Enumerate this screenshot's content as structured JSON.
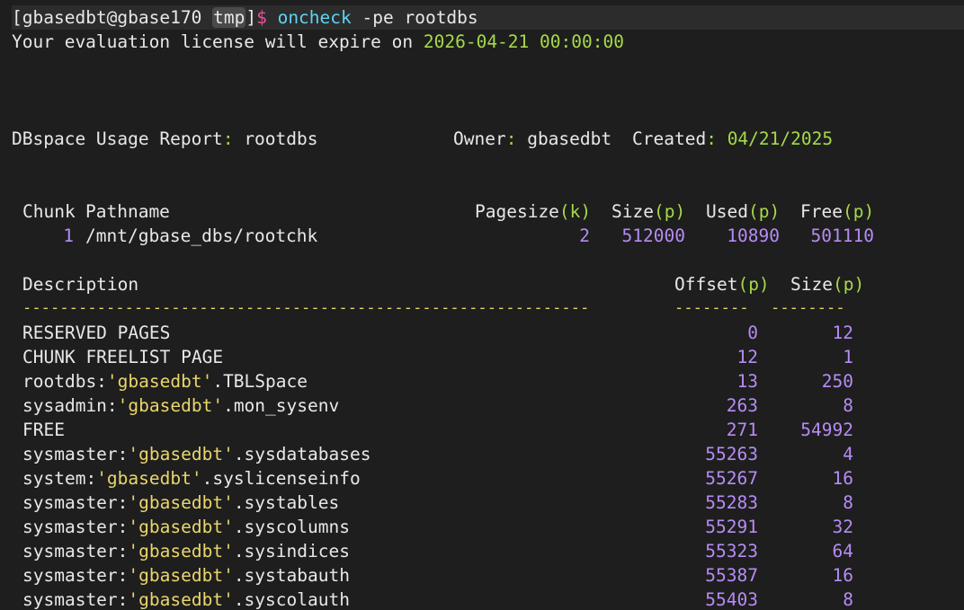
{
  "prompt": {
    "open_bracket": "[",
    "user_host": "gbasedbt@gbase170",
    "space": " ",
    "dir": "tmp",
    "close_bracket": "]",
    "symbol": "$",
    "command": "oncheck",
    "args": "-pe rootdbs"
  },
  "license": {
    "text": "Your evaluation license will expire on",
    "date": "2026-04-21",
    "time": "00:00:00"
  },
  "report": {
    "label": "DBspace Usage Report",
    "colon": ":",
    "dbspace": "rootdbs",
    "owner_label": "Owner",
    "owner_colon": ":",
    "owner": "gbasedbt",
    "created_label": "Created",
    "created_colon": ":",
    "created": "04/21/2025"
  },
  "chunk_table": {
    "headers": {
      "chunk": "Chunk",
      "pathname": "Pathname",
      "pagesize": "Pagesize",
      "pagesize_unit": "(k)",
      "size": "Size",
      "size_unit": "(p)",
      "used": "Used",
      "used_unit": "(p)",
      "free": "Free",
      "free_unit": "(p)"
    },
    "row": {
      "chunk": "1",
      "pathname": "/mnt/gbase_dbs/rootchk",
      "pagesize": "2",
      "size": "512000",
      "used": "10890",
      "free": "501110"
    }
  },
  "extent_table": {
    "headers": {
      "description": "Description",
      "offset": "Offset",
      "offset_unit": "(p)",
      "size": "Size",
      "size_unit": "(p)"
    },
    "separator_desc": "-------------------------------------------------------------",
    "separator_offset": "--------",
    "separator_size": "--------",
    "rows": [
      {
        "prefix": "RESERVED PAGES",
        "owner": "",
        "suffix": "",
        "offset": "0",
        "size": "12"
      },
      {
        "prefix": "CHUNK FREELIST PAGE",
        "owner": "",
        "suffix": "",
        "offset": "12",
        "size": "1"
      },
      {
        "prefix": "rootdbs:",
        "owner": "'gbasedbt'",
        "suffix": ".TBLSpace",
        "offset": "13",
        "size": "250"
      },
      {
        "prefix": "sysadmin:",
        "owner": "'gbasedbt'",
        "suffix": ".mon_sysenv",
        "offset": "263",
        "size": "8"
      },
      {
        "prefix": "FREE",
        "owner": "",
        "suffix": "",
        "offset": "271",
        "size": "54992"
      },
      {
        "prefix": "sysmaster:",
        "owner": "'gbasedbt'",
        "suffix": ".sysdatabases",
        "offset": "55263",
        "size": "4"
      },
      {
        "prefix": "system:",
        "owner": "'gbasedbt'",
        "suffix": ".syslicenseinfo",
        "offset": "55267",
        "size": "16"
      },
      {
        "prefix": "sysmaster:",
        "owner": "'gbasedbt'",
        "suffix": ".systables",
        "offset": "55283",
        "size": "8"
      },
      {
        "prefix": "sysmaster:",
        "owner": "'gbasedbt'",
        "suffix": ".syscolumns",
        "offset": "55291",
        "size": "32"
      },
      {
        "prefix": "sysmaster:",
        "owner": "'gbasedbt'",
        "suffix": ".sysindices",
        "offset": "55323",
        "size": "64"
      },
      {
        "prefix": "sysmaster:",
        "owner": "'gbasedbt'",
        "suffix": ".systabauth",
        "offset": "55387",
        "size": "16"
      },
      {
        "prefix": "sysmaster:",
        "owner": "'gbasedbt'",
        "suffix": ".syscolauth",
        "offset": "55403",
        "size": "8"
      }
    ]
  },
  "colors": {
    "background": "#1e1e1e",
    "text": "#e8e8e8",
    "green": "#a5d94a",
    "cyan": "#5ed4f2",
    "pink": "#f0509a",
    "purple": "#b68cf5",
    "yellow": "#e9d66b"
  }
}
